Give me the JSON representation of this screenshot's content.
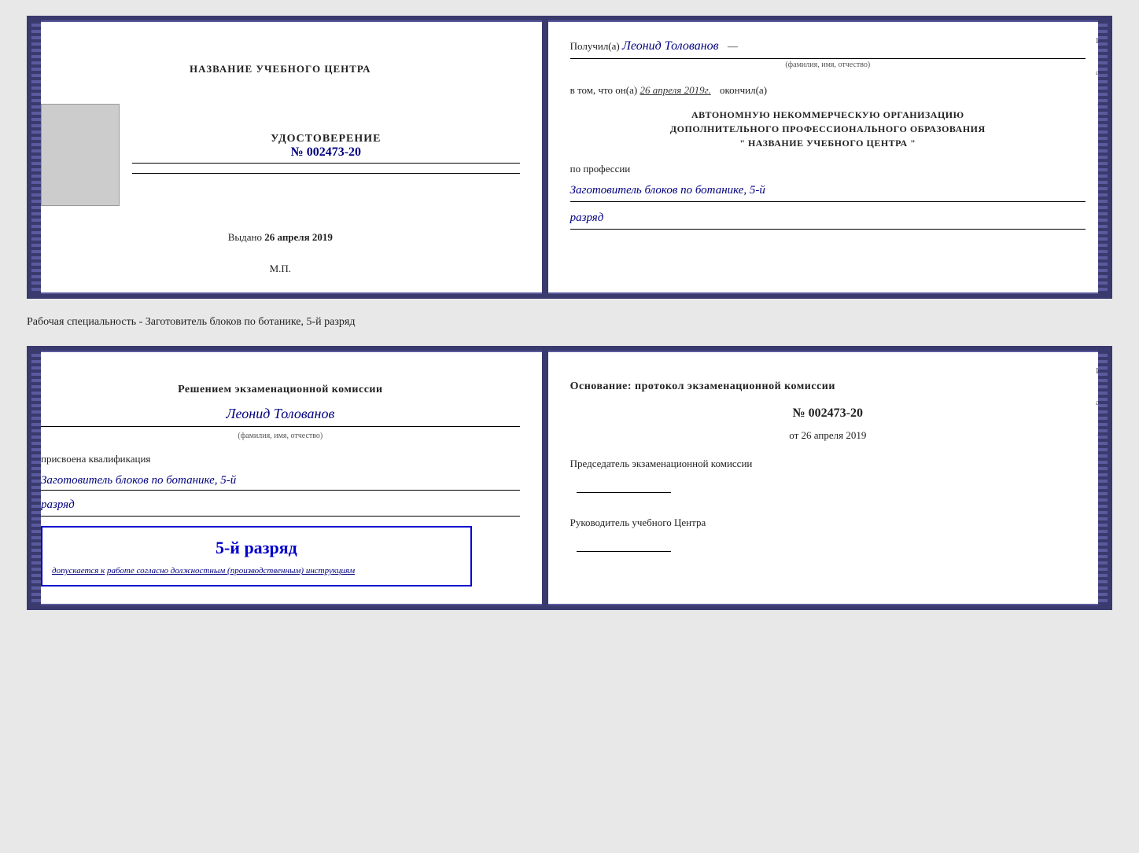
{
  "upper_cert": {
    "left": {
      "training_center": "НАЗВАНИЕ УЧЕБНОГО ЦЕНТРА",
      "cert_title": "УДОСТОВЕРЕНИЕ",
      "cert_number_prefix": "№",
      "cert_number": "002473-20",
      "issued_label": "Выдано",
      "issued_date": "26 апреля 2019",
      "mp_label": "М.П."
    },
    "right": {
      "received_label": "Получил(а)",
      "recipient_name": "Леонид Толованов",
      "fio_label": "(фамилия, имя, отчество)",
      "completion_prefix": "в том, что он(а)",
      "completion_date": "26 апреля 2019г.",
      "completion_suffix": "окончил(а)",
      "org_line1": "АВТОНОМНУЮ НЕКОММЕРЧЕСКУЮ ОРГАНИЗАЦИЮ",
      "org_line2": "ДОПОЛНИТЕЛЬНОГО ПРОФЕССИОНАЛЬНОГО ОБРАЗОВАНИЯ",
      "org_line3": "\" НАЗВАНИЕ УЧЕБНОГО ЦЕНТРА \"",
      "profession_label": "по профессии",
      "profession_name": "Заготовитель блоков по ботанике, 5-й",
      "rank": "разряд"
    }
  },
  "specialty_label": "Рабочая специальность - Заготовитель блоков по ботанике, 5-й разряд",
  "lower_cert": {
    "left": {
      "commission_heading": "Решением экзаменационной комиссии",
      "person_name": "Леонид Толованов",
      "fio_label": "(фамилия, имя, отчество)",
      "qualification_label": "присвоена квалификация",
      "qualification_name": "Заготовитель блоков по ботанике, 5-й",
      "rank": "разряд",
      "stamp_rank": "5-й разряд",
      "admit_text": "допускается к",
      "admit_details": "работе согласно должностным (производственным) инструкциям"
    },
    "right": {
      "basis_heading": "Основание: протокол экзаменационной комиссии",
      "number_prefix": "№",
      "protocol_number": "002473-20",
      "date_prefix": "от",
      "protocol_date": "26 апреля 2019",
      "chairman_label": "Председатель экзаменационной комиссии",
      "director_label": "Руководитель учебного Центра"
    }
  },
  "edge_marks": {
    "mark1": "И",
    "mark2": "а",
    "mark3": "←"
  }
}
